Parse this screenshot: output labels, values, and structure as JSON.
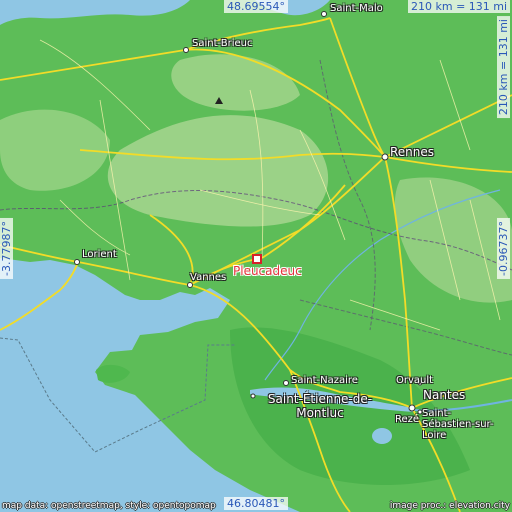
{
  "map": {
    "place": "Pleucadeuc",
    "coords": {
      "top_latitude": "48.69554°",
      "bottom_latitude": "46.80481°",
      "left_longitude": "-3.77987°",
      "right_longitude": "-0.96737°"
    },
    "scale": {
      "horizontal": "210 km = 131 mi",
      "vertical": "210 km = 131 mi"
    },
    "cities": [
      {
        "name": "Saint-Malo",
        "size": "small"
      },
      {
        "name": "Saint-Brieuc",
        "size": "small"
      },
      {
        "name": "Rennes",
        "size": "large"
      },
      {
        "name": "Lorient",
        "size": "small"
      },
      {
        "name": "Vannes",
        "size": "small"
      },
      {
        "name": "Saint-Nazaire",
        "size": "small"
      },
      {
        "name": "Saint-Étienne-de-Montluc",
        "size": "large"
      },
      {
        "name": "Orvault",
        "size": "small"
      },
      {
        "name": "Nantes",
        "size": "large"
      },
      {
        "name": "Saint-Sébastien-sur-Loire",
        "size": "small"
      },
      {
        "name": "Rezé",
        "size": "small"
      }
    ],
    "attribution": {
      "left": "map data: openstreetmap, style: opentopomap",
      "right": "image proc.: elevation.city"
    },
    "colors": {
      "sea": "#8fc6e4",
      "lowland": "#4fb84e",
      "upland": "#9fd58a",
      "road": "#f2dc28",
      "place_marker": "#d81f2a"
    }
  }
}
